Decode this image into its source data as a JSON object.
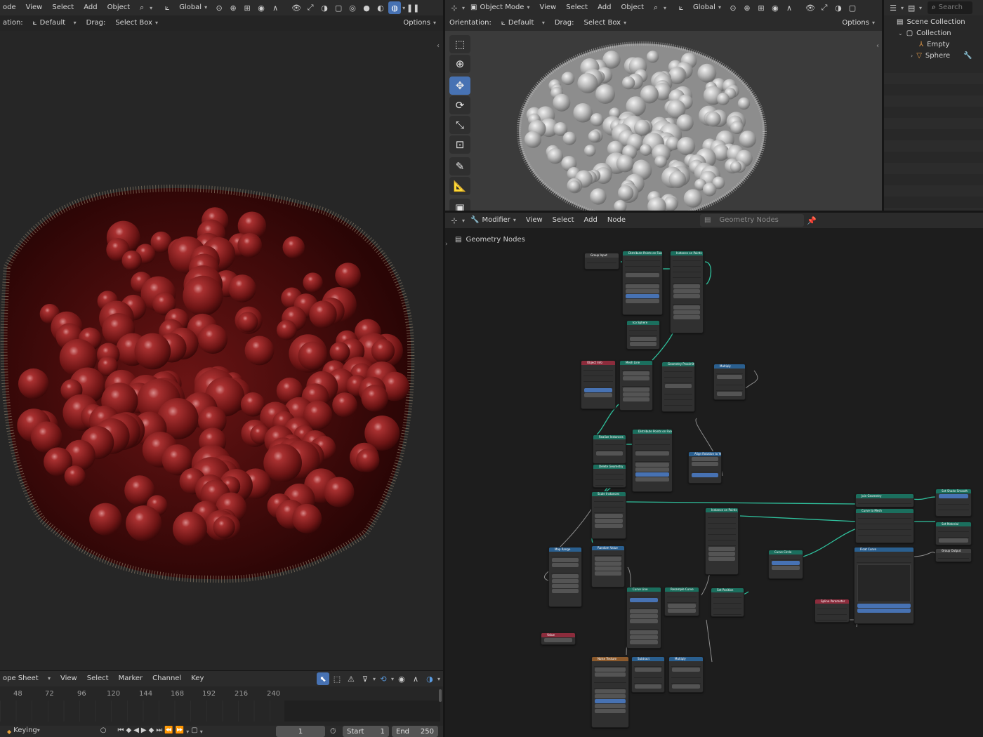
{
  "left_viewport": {
    "header": {
      "mode_label": "ode",
      "menus": [
        "View",
        "Select",
        "Add",
        "Object"
      ],
      "orientation_global": "Global"
    },
    "tool_header": {
      "orientation_label": "ation:",
      "orientation_value": "Default",
      "drag_label": "Drag:",
      "drag_value": "Select Box",
      "options_label": "Options"
    }
  },
  "right_viewport": {
    "header": {
      "mode_label": "Object Mode",
      "menus": [
        "View",
        "Select",
        "Add",
        "Object"
      ],
      "orientation_global": "Global"
    },
    "tool_header": {
      "orientation_label": "Orientation:",
      "orientation_value": "Default",
      "drag_label": "Drag:",
      "drag_value": "Select Box",
      "options_label": "Options"
    },
    "tools": [
      "select-box",
      "cursor",
      "move",
      "rotate",
      "scale",
      "transform",
      "annotate",
      "measure",
      "add-cube"
    ]
  },
  "outliner": {
    "search_placeholder": "Search",
    "items": [
      {
        "label": "Scene Collection",
        "icon": "scene-collection-icon"
      },
      {
        "label": "Collection",
        "icon": "collection-icon"
      },
      {
        "label": "Empty",
        "icon": "empty-icon"
      },
      {
        "label": "Sphere",
        "icon": "mesh-icon"
      }
    ]
  },
  "node_editor": {
    "header": {
      "editor_type": "Modifier",
      "menus": [
        "View",
        "Select",
        "Add",
        "Node"
      ],
      "tree_name": "Geometry Nodes"
    },
    "breadcrumb": "Geometry Nodes",
    "nodes": [
      "Group Input",
      "Distribute Points on Faces",
      "Instance on Points",
      "Ico Sphere",
      "Object Info",
      "Mesh Line",
      "Geometry Proximity",
      "Multiply",
      "Realize Instances",
      "Delete Geometry",
      "Distribute Points on Faces",
      "Align Rotation to Vector",
      "Scale Instances",
      "Map Range",
      "Random Value",
      "Instance on Points",
      "Join Geometry",
      "Curve to Mesh",
      "Set Shade Smooth",
      "Set Material",
      "Group Output",
      "Curve Circle",
      "Float Curve",
      "Spline Parameter",
      "Curve Line",
      "Resample Curve",
      "Set Position",
      "Value",
      "Noise Texture",
      "Subtract",
      "Multiply"
    ]
  },
  "dope_sheet": {
    "mode": "ope Sheet",
    "menus": [
      "View",
      "Select",
      "Marker",
      "Channel",
      "Key"
    ],
    "frame_ticks": [
      "48",
      "72",
      "96",
      "120",
      "144",
      "168",
      "192",
      "216",
      "240"
    ]
  },
  "playback": {
    "keying_label": "Keying",
    "current_frame": "1",
    "start_label": "Start",
    "start_value": "1",
    "end_label": "End",
    "end_value": "250"
  }
}
